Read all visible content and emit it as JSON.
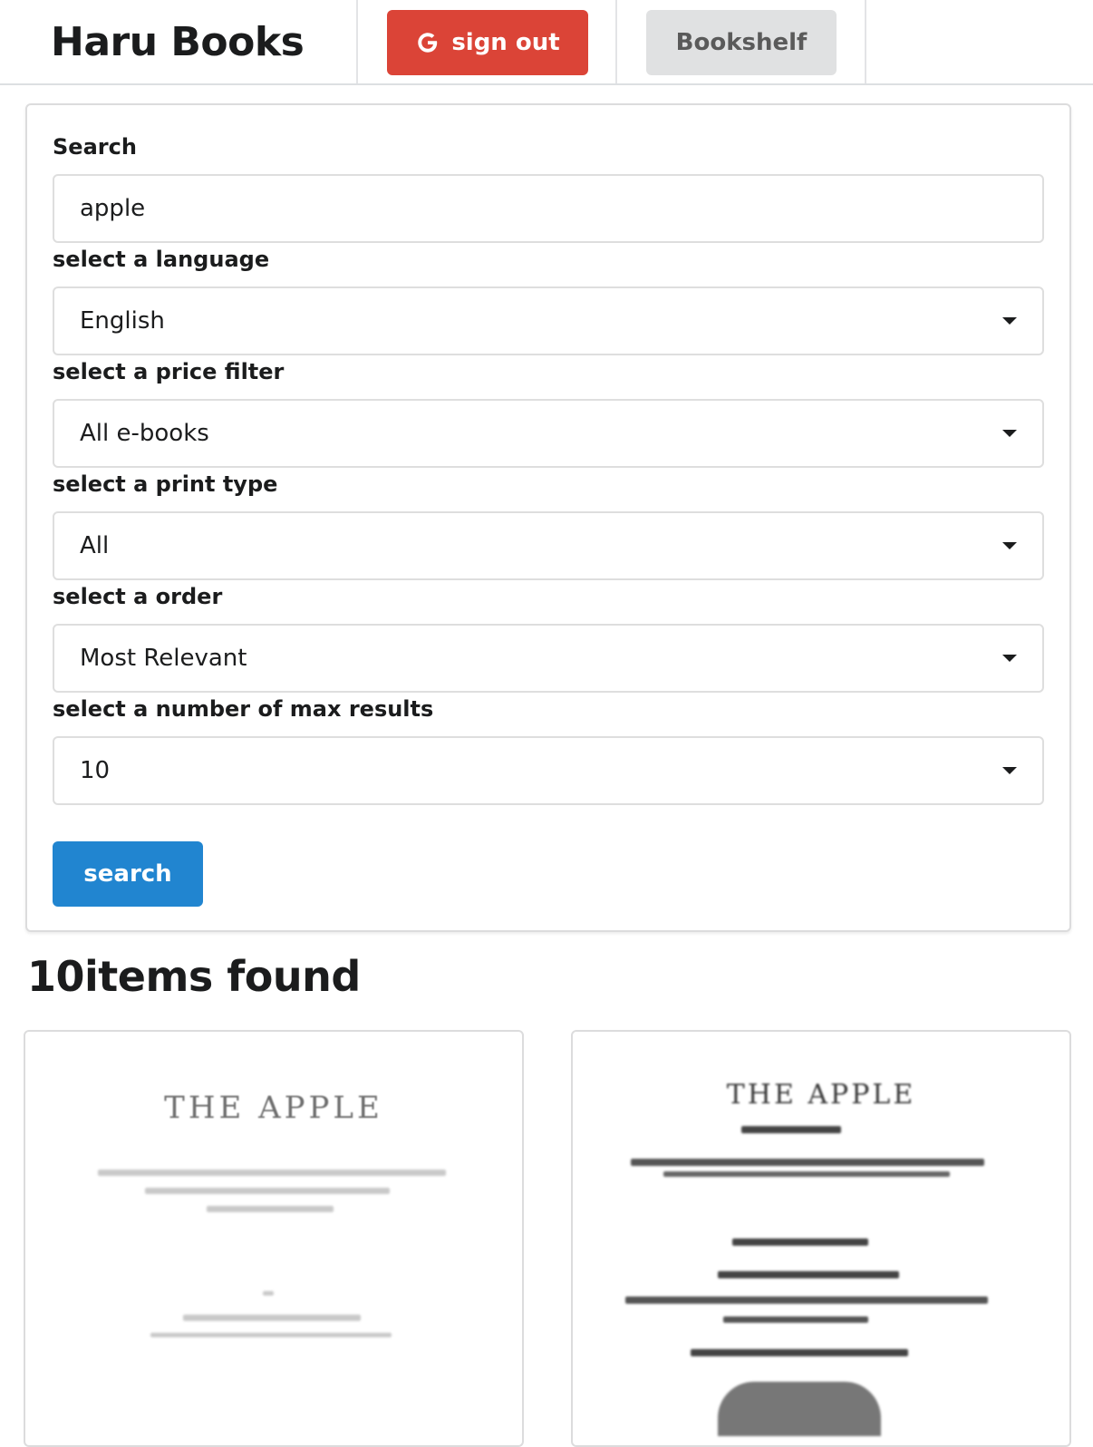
{
  "header": {
    "brand": "Haru Books",
    "signout_label": "sign out",
    "bookshelf_label": "Bookshelf"
  },
  "form": {
    "search_label": "Search",
    "search_value": "apple",
    "language_label": "select a language",
    "language_value": "English",
    "price_label": "select a price filter",
    "price_value": "All e-books",
    "print_label": "select a print type",
    "print_value": "All",
    "order_label": "select a order",
    "order_value": "Most Relevant",
    "max_label": "select a number of max results",
    "max_value": "10",
    "search_button": "search"
  },
  "results": {
    "title": "10items found",
    "books": [
      {
        "cover_title": "THE APPLE"
      },
      {
        "cover_title": "THE APPLE"
      }
    ]
  },
  "colors": {
    "signout": "#db4437",
    "search_button": "#2185d0",
    "bookshelf_button": "#e0e1e2"
  }
}
